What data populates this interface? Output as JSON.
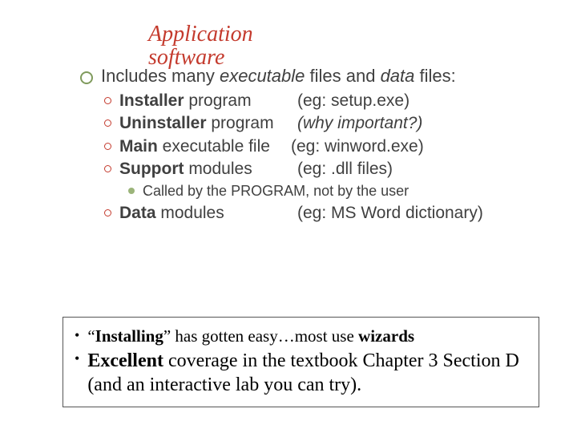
{
  "title_line1": "Application",
  "title_line2": "software",
  "intro_prefix": "Includes many ",
  "intro_em1": "executable",
  "intro_mid": " files and ",
  "intro_em2": "data",
  "intro_suffix": " files:",
  "items": [
    {
      "bold": "Installer",
      "rest": " program",
      "paren": "(eg:    setup.exe)"
    },
    {
      "bold": "Uninstaller",
      "rest": " program",
      "paren_italic": "(why important?)"
    },
    {
      "bold": "Main",
      "rest": " executable file",
      "paren": "(eg:    winword.exe)"
    },
    {
      "bold": "Support",
      "rest": " modules",
      "paren": "(eg:   .dll  files)"
    }
  ],
  "subnote": "Called by the PROGRAM, not by the user",
  "item5": {
    "bold": "Data",
    "rest": " modules",
    "paren": "(eg:  MS Word dictionary)"
  },
  "box1_a": "“",
  "box1_b": "Installing",
  "box1_c": "” has gotten easy…most use ",
  "box1_d": "wizards",
  "box2_a": "Excellent",
  "box2_b": " coverage in the textbook Chapter 3 Section D (and an interactive lab you can try)."
}
